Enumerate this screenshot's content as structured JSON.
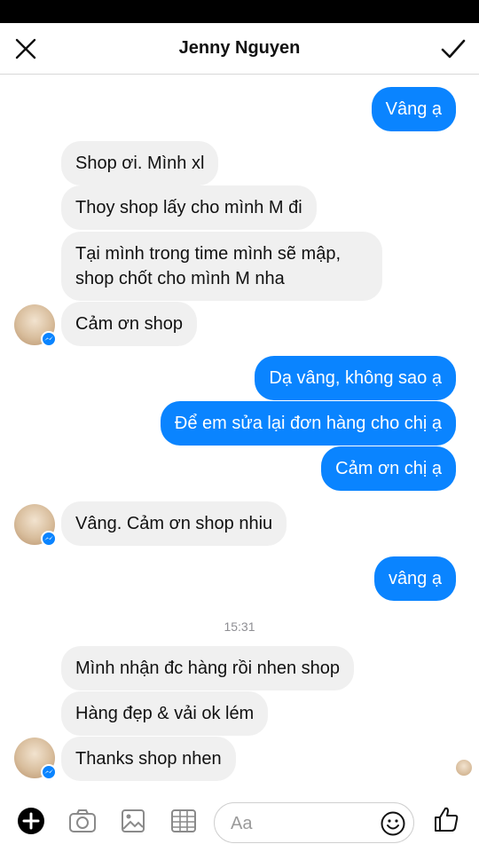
{
  "header": {
    "title": "Jenny Nguyen"
  },
  "messages": [
    {
      "dir": "out",
      "text": "Vâng ạ"
    },
    {
      "dir": "in",
      "text": "Shop ơi. Mình xl"
    },
    {
      "dir": "in",
      "text": "Thoy shop lấy cho mình M đi"
    },
    {
      "dir": "in",
      "text": "Tại mình trong time mình sẽ mập, shop chốt cho mình M nha"
    },
    {
      "dir": "in",
      "text": "Cảm ơn shop"
    },
    {
      "dir": "out",
      "text": "Dạ vâng, không sao ạ"
    },
    {
      "dir": "out",
      "text": "Để em sửa lại đơn hàng cho chị ạ"
    },
    {
      "dir": "out",
      "text": "Cảm ơn chị ạ"
    },
    {
      "dir": "in",
      "text": "Vâng. Cảm ơn shop nhiu"
    },
    {
      "dir": "out",
      "text": "vâng ạ"
    },
    {
      "dir": "in",
      "text": "Mình nhận đc hàng rồi nhen shop"
    },
    {
      "dir": "in",
      "text": "Hàng đẹp & vải ok lém"
    },
    {
      "dir": "in",
      "text": "Thanks shop nhen"
    }
  ],
  "timestamp": "15:31",
  "composer": {
    "placeholder": "Aa",
    "icons": [
      "plus-icon",
      "camera-icon",
      "gallery-icon",
      "grid-icon",
      "emoji-icon",
      "thumbs-up-icon"
    ]
  },
  "colors": {
    "outgoing_bubble": "#0a84ff",
    "incoming_bubble": "#f0f0f0",
    "messenger_badge": "#0a84ff"
  }
}
